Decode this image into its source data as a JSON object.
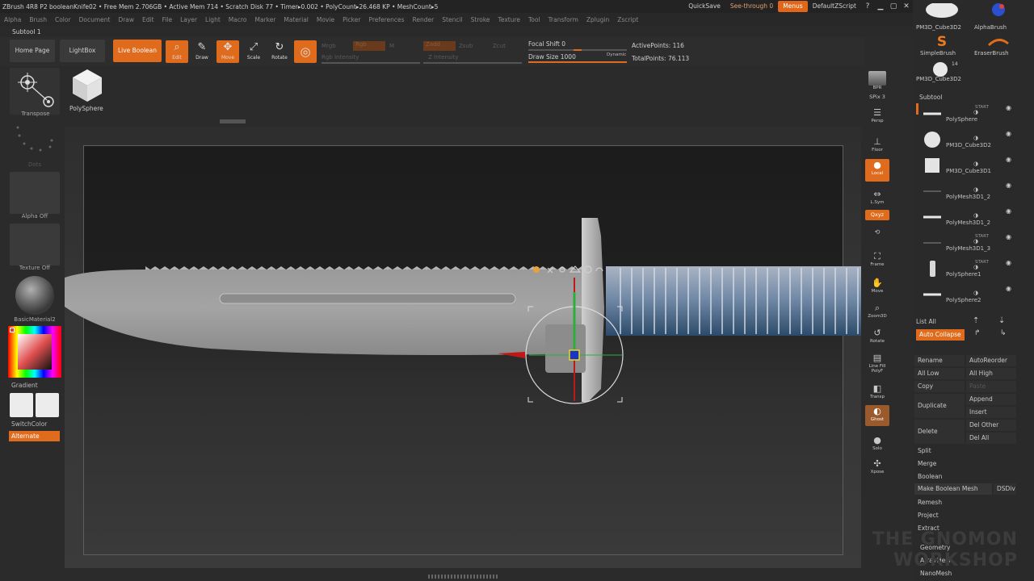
{
  "titlebar": {
    "info": "ZBrush 4R8 P2   booleanKnife02   • Free Mem 2.706GB • Active Mem 714 • Scratch Disk 77 • Timer▸0.002 • PolyCount▸26.468 KP • MeshCount▸5",
    "quicksave": "QuickSave",
    "seethrough": "See-through  0",
    "menus": "Menus",
    "script": "DefaultZScript"
  },
  "menubar": [
    "Alpha",
    "Brush",
    "Color",
    "Document",
    "Draw",
    "Edit",
    "File",
    "Layer",
    "Light",
    "Macro",
    "Marker",
    "Material",
    "Movie",
    "Picker",
    "Preferences",
    "Render",
    "Stencil",
    "Stroke",
    "Texture",
    "Tool",
    "Transform",
    "Zplugin",
    "Zscript"
  ],
  "subtool_label": "Subtool 1",
  "toolbar": {
    "home": "Home Page",
    "lightbox": "LightBox",
    "liveboolean": "Live Boolean",
    "edit": "Edit",
    "draw": "Draw",
    "move": "Move",
    "scale": "Scale",
    "rotate": "Rotate",
    "mrgb": "Mrgb",
    "rgb": "Rgb",
    "m": "M",
    "rgb_intensity": "Rgb Intensity",
    "zadd": "Zadd",
    "zsub": "Zsub",
    "zcut": "Zcut",
    "z_intensity": "Z Intensity",
    "focal_shift": "Focal Shift 0",
    "draw_size": "Draw Size 1000",
    "dynamic": "Dynamic",
    "active_points": "ActivePoints: 116",
    "total_points": "TotalPoints: 76.113"
  },
  "leftshelf": {
    "transpose": "Transpose",
    "polysphere": "PolySphere",
    "dots": "Dots",
    "alpha": "Alpha Off",
    "texture": "Texture Off",
    "material": "BasicMaterial2",
    "gradient": "Gradient",
    "switchcolor": "SwitchColor",
    "alternate": "Alternate"
  },
  "righttools": {
    "bpr": "BPR",
    "spix": "SPix 3",
    "dynamic": "Dynamic",
    "persp": "Persp",
    "floor": "Floor",
    "local": "Local",
    "lsym": "L.Sym",
    "xyz": "Qxyz",
    "frame": "Frame",
    "move": "Move",
    "zoom3d": "Zoom3D",
    "rotate": "Rotate",
    "linefill": "Line Fill PolyF",
    "transp": "Transp",
    "ghost": "Ghost",
    "solo": "Solo",
    "xpose": "Xpose"
  },
  "rightpanel": {
    "brushes": [
      "PM3D_Cube3D2",
      "AlphaBrush",
      "SimpleBrush",
      "EraserBrush",
      "PM3D_Cube3D2"
    ],
    "brush_count": "14",
    "subtool_title": "Subtool",
    "subtools": [
      {
        "name": "PolySphere",
        "tag": "START"
      },
      {
        "name": "PM3D_Cube3D2",
        "tag": ""
      },
      {
        "name": "PM3D_Cube3D1",
        "tag": ""
      },
      {
        "name": "PolyMesh3D1_2",
        "tag": ""
      },
      {
        "name": "PolyMesh3D1_2",
        "tag": ""
      },
      {
        "name": "PolyMesh3D1_3",
        "tag": "START"
      },
      {
        "name": "PolySphere1",
        "tag": "START"
      },
      {
        "name": "PolySphere2",
        "tag": ""
      }
    ],
    "list_all": "List All",
    "auto_collapse": "Auto Collapse",
    "rename": "Rename",
    "autoreorder": "AutoReorder",
    "all_low": "All Low",
    "all_high": "All High",
    "copy": "Copy",
    "paste": "Paste",
    "duplicate": "Duplicate",
    "append": "Append",
    "insert": "Insert",
    "delete": "Delete",
    "del_other": "Del Other",
    "del_all": "Del All",
    "split": "Split",
    "merge": "Merge",
    "boolean": "Boolean",
    "make_boolean": "Make Boolean Mesh",
    "dsdiv": "DSDiv",
    "remesh": "Remesh",
    "project": "Project",
    "extract": "Extract",
    "geometry": "Geometry",
    "arraymesh": "ArrayMesh",
    "nanomesh": "NanoMesh"
  },
  "watermark": "THE GNOMON WORKSHOP",
  "colors": {
    "accent": "#e06b1c",
    "bg": "#2b2b2b"
  }
}
